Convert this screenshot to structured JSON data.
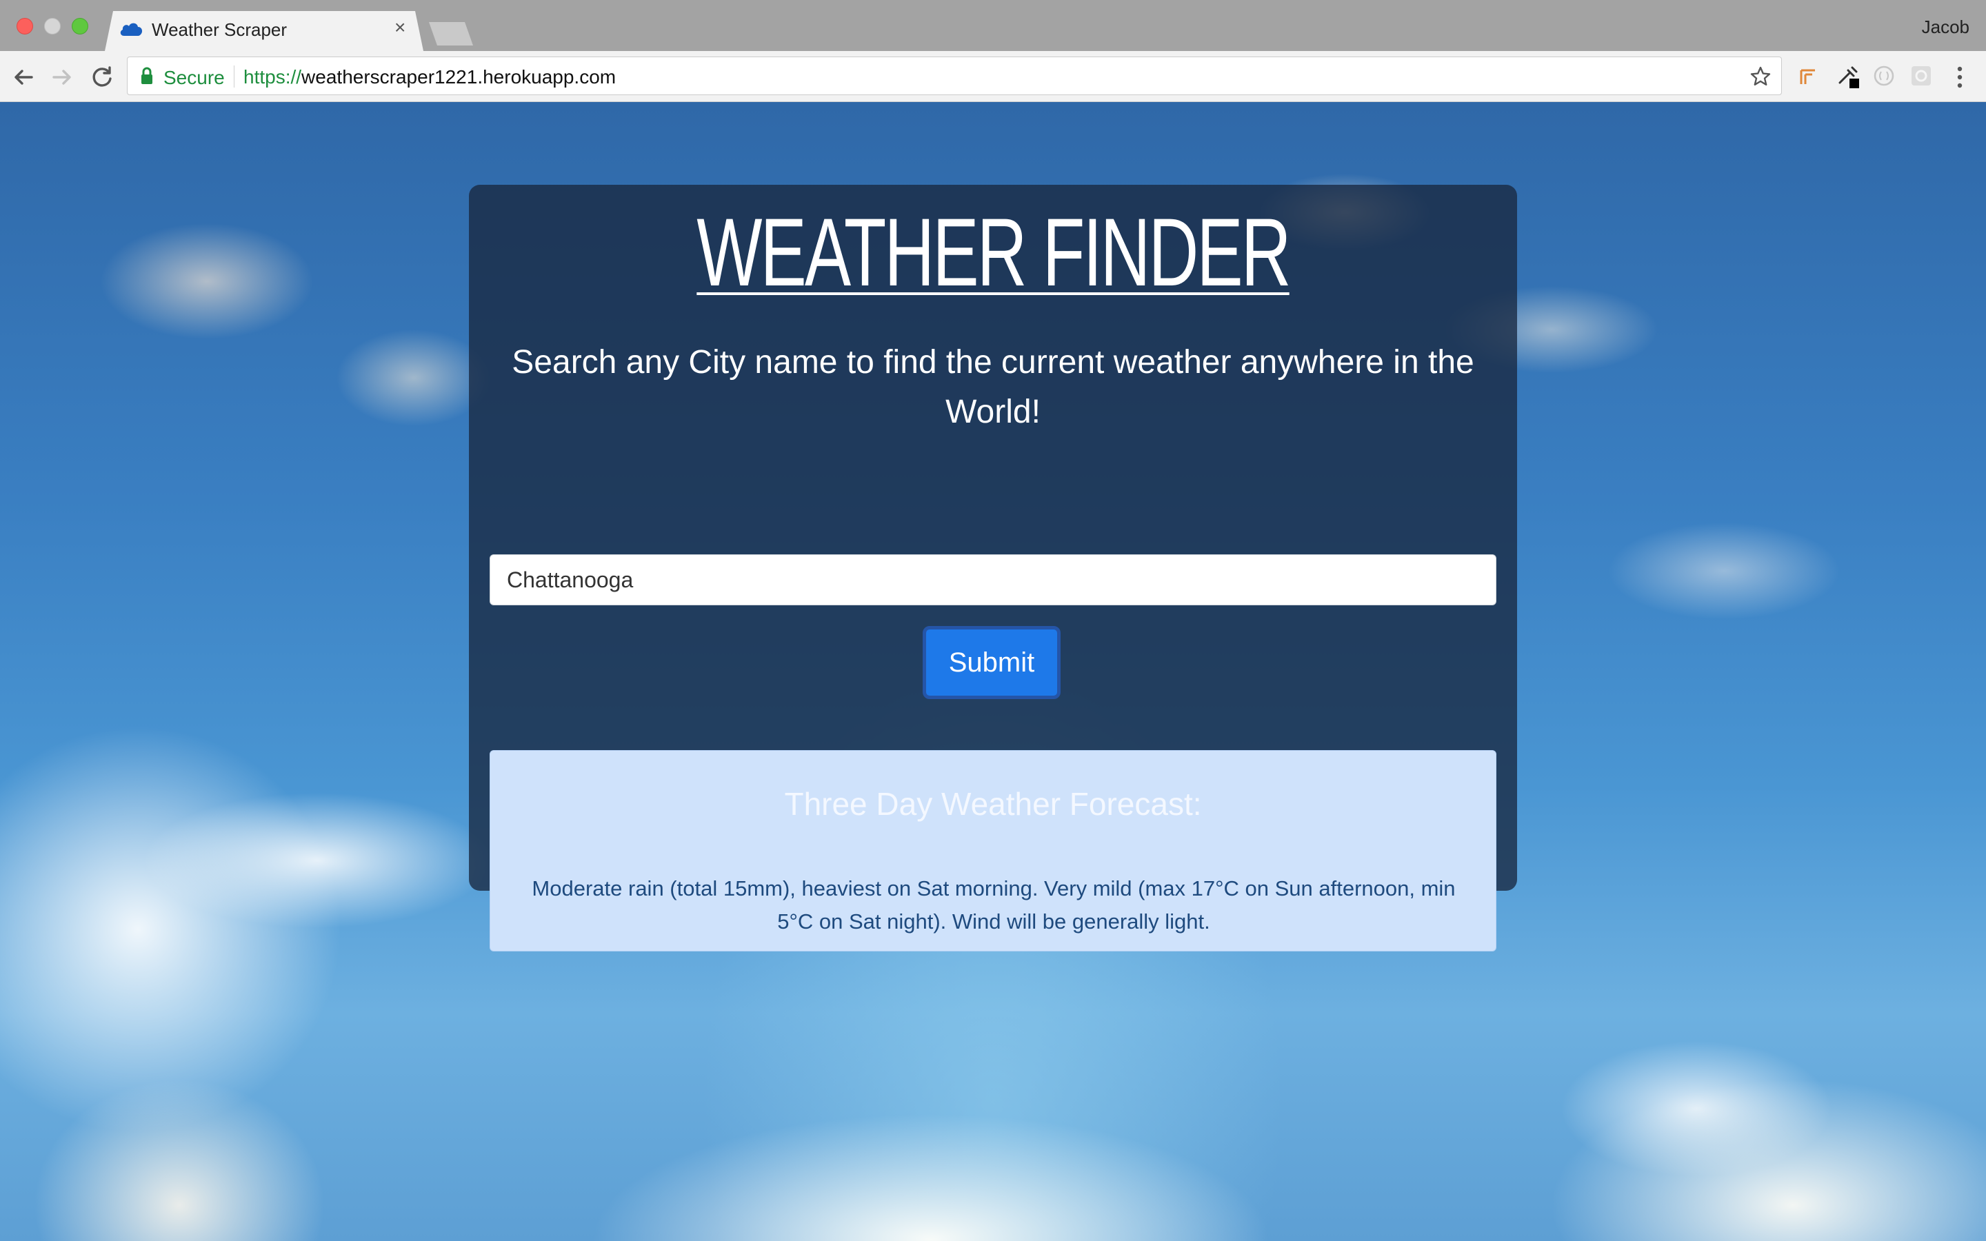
{
  "browser": {
    "tab_title": "Weather Scraper",
    "tab_close": "×",
    "user_name": "Jacob",
    "secure_label": "Secure",
    "url_scheme": "https://",
    "url_host": "weatherscraper1221.herokuapp.com",
    "icons": [
      "back-arrow-icon",
      "forward-arrow-icon",
      "reload-icon",
      "lock-icon",
      "star-icon",
      "cloud-favicon-icon",
      "menu-dots-icon"
    ],
    "colors": {
      "secure_green": "#1e8e3e",
      "chrome_bg": "#f2f2f2",
      "titlebar_bg": "#a3a3a3"
    }
  },
  "page": {
    "title": "WEATHER FINDER",
    "subtitle": "Search any City name to find the current weather anywhere in the World!",
    "search": {
      "value": "Chattanooga"
    },
    "submit_label": "Submit",
    "forecast": {
      "heading": "Three Day Weather Forecast:",
      "text": "Moderate rain (total 15mm), heaviest on Sat morning. Very mild (max 17°C on Sun afternoon, min 5°C on Sat night). Wind will be generally light."
    },
    "colors": {
      "button_blue": "#1e79e9",
      "forecast_bg": "#cfe2fb",
      "forecast_text": "#1e4a7e"
    }
  }
}
